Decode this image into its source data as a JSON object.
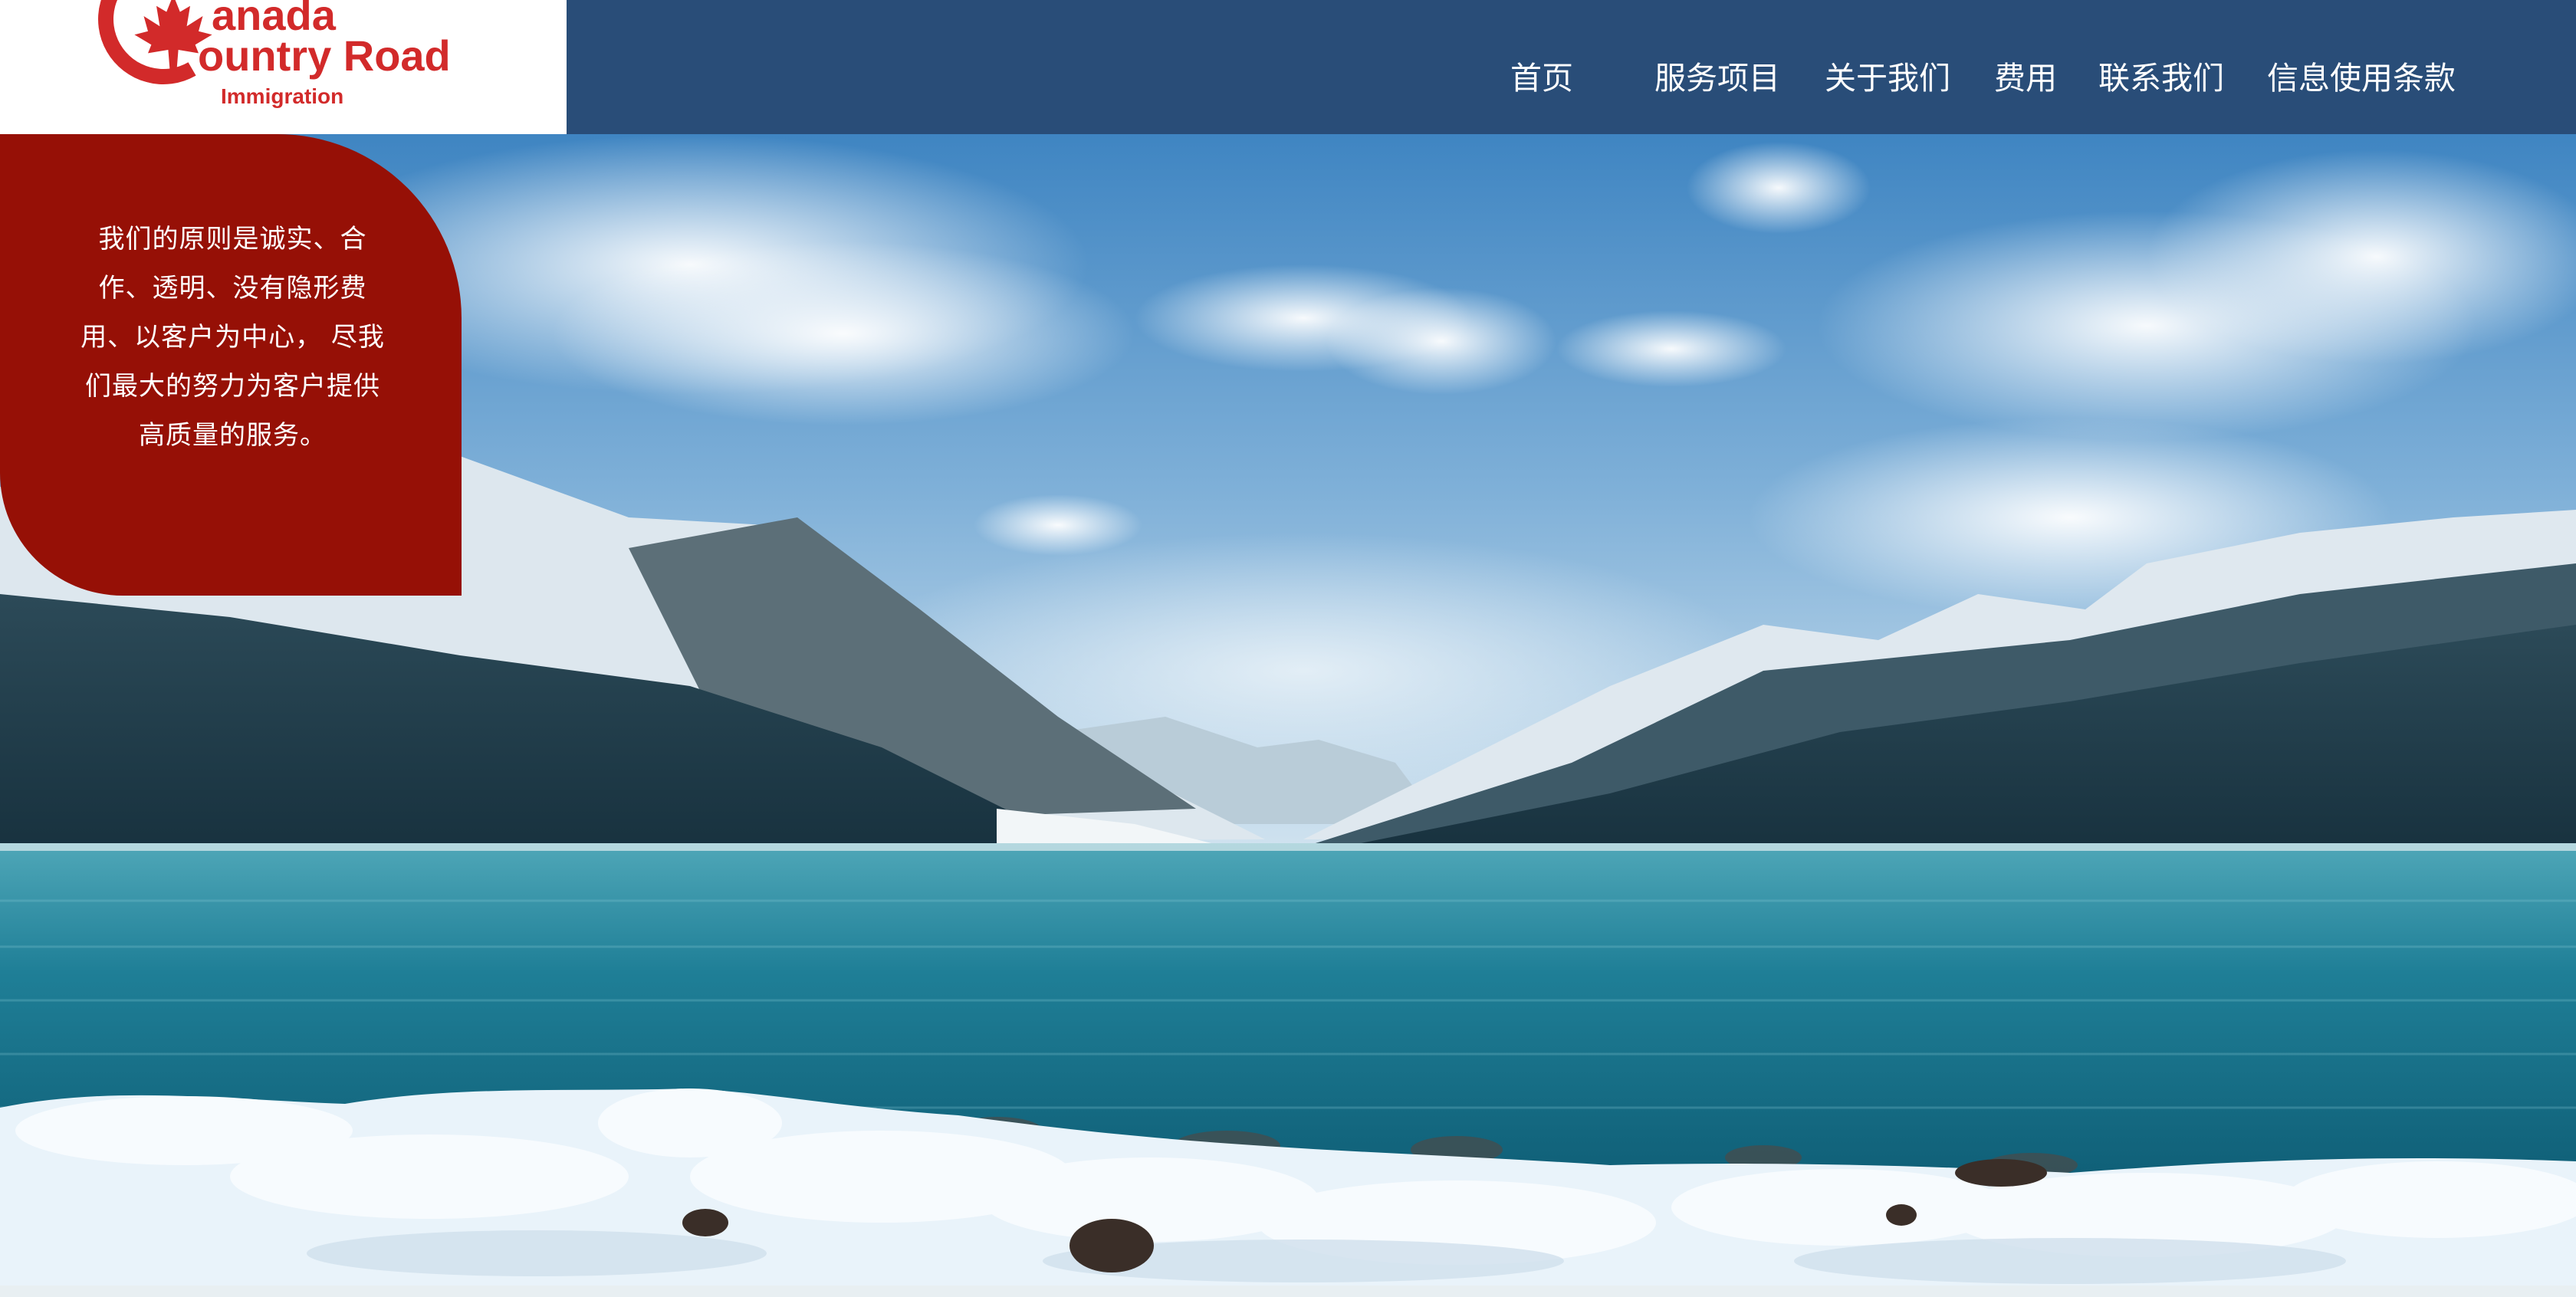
{
  "logo": {
    "line1": "anada",
    "line2": "ountry Road",
    "line3": "Immigration",
    "brand_color": "#d22a2a",
    "icon": "maple-leaf-icon"
  },
  "nav": {
    "items": [
      {
        "label": "首页"
      },
      {
        "label": "服务项目"
      },
      {
        "label": "关于我们"
      },
      {
        "label": "费用"
      },
      {
        "label": "联系我们"
      },
      {
        "label": "信息使用条款"
      }
    ],
    "background": "#294d78",
    "text_color": "#ffffff"
  },
  "hero": {
    "principle_text": "我们的原则是诚实、合作、透明、没有隐形费用、以客户为中心， 尽我们最大的努力为客户提供高质量的服务。",
    "bubble_color": "#961006",
    "scene": "snowy mountain lake landscape"
  }
}
